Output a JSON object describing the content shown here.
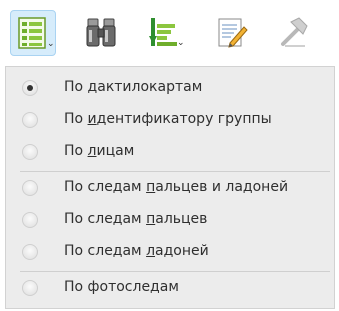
{
  "toolbar": {
    "buttons": [
      {
        "icon": "list-view-icon",
        "active": true,
        "has_dropdown": true
      },
      {
        "icon": "binoculars-icon",
        "active": false,
        "has_dropdown": false
      },
      {
        "icon": "sort-descending-icon",
        "active": false,
        "has_dropdown": true
      },
      {
        "icon": "edit-document-icon",
        "active": false,
        "has_dropdown": false
      },
      {
        "icon": "hammer-icon",
        "active": false,
        "has_dropdown": false
      }
    ],
    "caret_glyph": "⌄"
  },
  "menu": {
    "selected_index": 0,
    "items": [
      {
        "pre": "По ",
        "accel": "д",
        "post": "актилокартам"
      },
      {
        "pre": "По ",
        "accel": "и",
        "post": "дентификатору группы"
      },
      {
        "pre": "По ",
        "accel": "л",
        "post": "ицам"
      },
      {
        "pre": "По следам ",
        "accel": "п",
        "post": "альцев и ладоней"
      },
      {
        "pre": "По следам ",
        "accel": "п",
        "post": "альцев"
      },
      {
        "pre": "По следам ",
        "accel": "л",
        "post": "адоней"
      },
      {
        "pre": "По фотоследам",
        "accel": "",
        "post": ""
      }
    ]
  },
  "colors": {
    "active_button_bg": "#d6ecfb",
    "menu_bg": "#ececec",
    "text": "#2f2f2f"
  }
}
